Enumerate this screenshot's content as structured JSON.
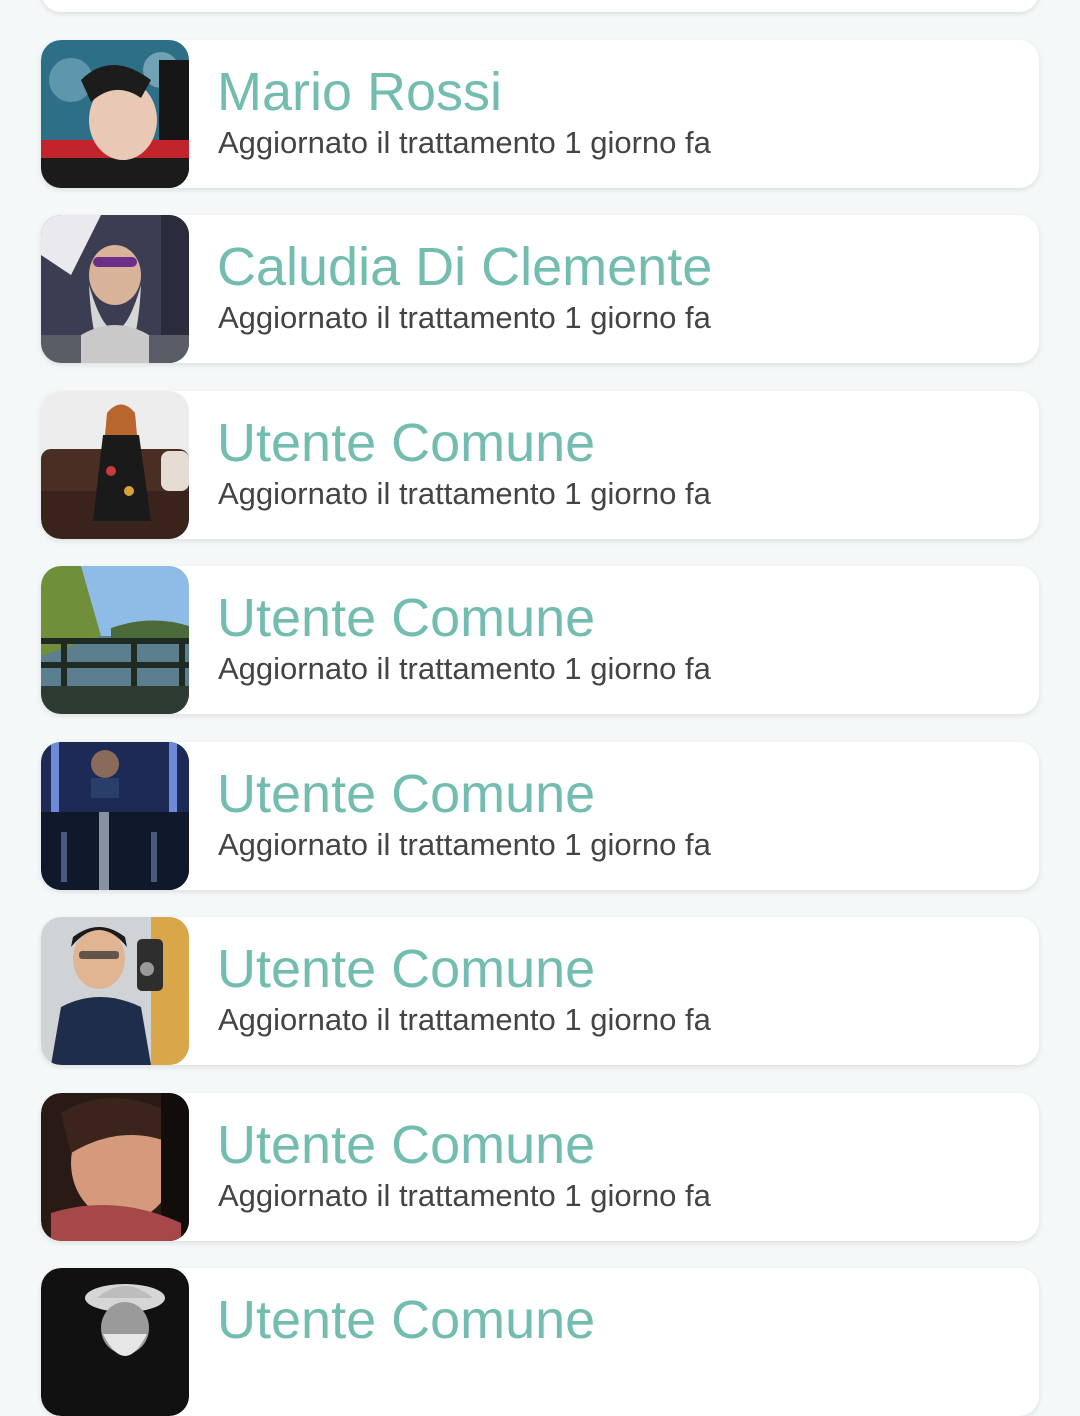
{
  "colors": {
    "background": "#f4f8f9",
    "card": "#ffffff",
    "name_text": "#72bcb0",
    "status_text": "#444444"
  },
  "patients": [
    {
      "name": "Mario Rossi",
      "status": "Aggiornato il trattamento 1 giorno fa",
      "avatar_icon": "user-photo-avatar"
    },
    {
      "name": "Caludia Di Clemente",
      "status": "Aggiornato il trattamento 1 giorno fa",
      "avatar_icon": "user-photo-avatar"
    },
    {
      "name": "Utente Comune",
      "status": "Aggiornato il trattamento 1 giorno fa",
      "avatar_icon": "user-photo-avatar"
    },
    {
      "name": "Utente Comune",
      "status": "Aggiornato il trattamento 1 giorno fa",
      "avatar_icon": "user-photo-avatar"
    },
    {
      "name": "Utente Comune",
      "status": "Aggiornato il trattamento 1 giorno fa",
      "avatar_icon": "user-photo-avatar"
    },
    {
      "name": "Utente Comune",
      "status": "Aggiornato il trattamento 1 giorno fa",
      "avatar_icon": "user-photo-avatar"
    },
    {
      "name": "Utente Comune",
      "status": "Aggiornato il trattamento 1 giorno fa",
      "avatar_icon": "user-photo-avatar"
    },
    {
      "name": "Utente Comune",
      "status": "",
      "avatar_icon": "user-photo-avatar"
    }
  ]
}
